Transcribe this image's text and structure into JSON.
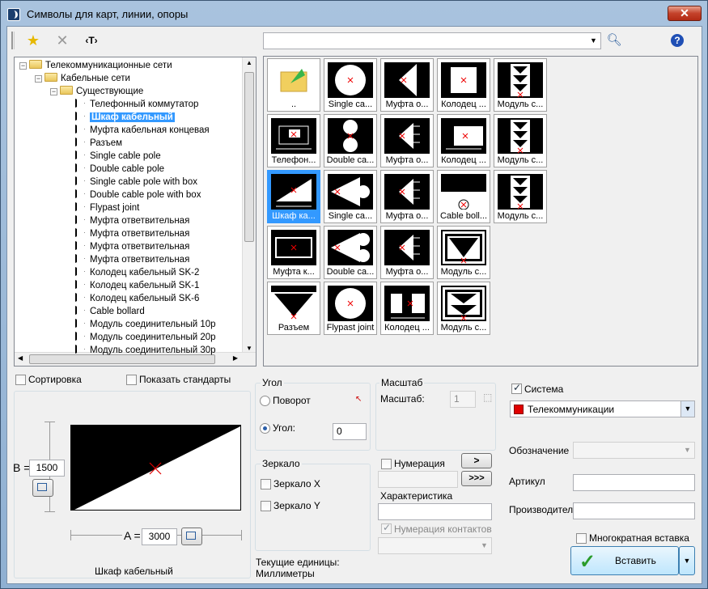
{
  "window": {
    "title": "Символы для карт, линии, опоры",
    "close": "✕"
  },
  "toolbar": {
    "text_tool": "‹T›",
    "search_placeholder": "",
    "help": "?"
  },
  "tree": [
    {
      "label": "Телекоммуникационные сети",
      "level": 0,
      "type": "folder",
      "toggle": "−"
    },
    {
      "label": "Кабельные сети",
      "level": 1,
      "type": "folder",
      "toggle": "−"
    },
    {
      "label": "Существующие",
      "level": 2,
      "type": "folder",
      "toggle": "−"
    },
    {
      "label": "Телефонный коммутатор",
      "level": 3,
      "type": "sym"
    },
    {
      "label": "Шкаф кабельный",
      "level": 3,
      "type": "sym",
      "selected": true
    },
    {
      "label": "Муфта кабельная концевая",
      "level": 3,
      "type": "sym"
    },
    {
      "label": "Разъем",
      "level": 3,
      "type": "sym"
    },
    {
      "label": "Single cable pole",
      "level": 3,
      "type": "sym"
    },
    {
      "label": "Double cable pole",
      "level": 3,
      "type": "sym"
    },
    {
      "label": "Single cable pole with box",
      "level": 3,
      "type": "sym"
    },
    {
      "label": "Double cable pole with box",
      "level": 3,
      "type": "sym"
    },
    {
      "label": "Flypast joint",
      "level": 3,
      "type": "sym"
    },
    {
      "label": "Муфта ответвительная",
      "level": 3,
      "type": "sym"
    },
    {
      "label": "Муфта ответвительная",
      "level": 3,
      "type": "sym"
    },
    {
      "label": "Муфта ответвительная",
      "level": 3,
      "type": "sym"
    },
    {
      "label": "Муфта ответвительная",
      "level": 3,
      "type": "sym"
    },
    {
      "label": "Колодец кабельный SK-2",
      "level": 3,
      "type": "sym"
    },
    {
      "label": "Колодец кабельный SK-1",
      "level": 3,
      "type": "sym"
    },
    {
      "label": "Колодец кабельный SK-6",
      "level": 3,
      "type": "sym"
    },
    {
      "label": "Cable bollard",
      "level": 3,
      "type": "sym"
    },
    {
      "label": "Модуль соединительный 10р",
      "level": 3,
      "type": "sym"
    },
    {
      "label": "Модуль соединительный 20р",
      "level": 3,
      "type": "sym"
    },
    {
      "label": "Модуль соединительный 30р",
      "level": 3,
      "type": "sym"
    }
  ],
  "grid": [
    {
      "cap": "..",
      "kind": "up"
    },
    {
      "cap": "Single ca...",
      "kind": "circle"
    },
    {
      "cap": "Муфта о...",
      "kind": "tri"
    },
    {
      "cap": "Колодец ...",
      "kind": "box"
    },
    {
      "cap": "Модуль с...",
      "kind": "mod"
    },
    {
      "cap": "Телефон...",
      "kind": "tel"
    },
    {
      "cap": "Double ca...",
      "kind": "dbl"
    },
    {
      "cap": "Муфта о...",
      "kind": "tri2"
    },
    {
      "cap": "Колодец ...",
      "kind": "box2"
    },
    {
      "cap": "Модуль с...",
      "kind": "mod"
    },
    {
      "cap": "Шкаф ка...",
      "kind": "cab",
      "selected": true
    },
    {
      "cap": "Single ca...",
      "kind": "pole"
    },
    {
      "cap": "Муфта о...",
      "kind": "tri2"
    },
    {
      "cap": "Cable boll...",
      "kind": "boll"
    },
    {
      "cap": "Модуль с...",
      "kind": "mod"
    },
    {
      "cap": "Муфта к...",
      "kind": "rect"
    },
    {
      "cap": "Double ca...",
      "kind": "dpole"
    },
    {
      "cap": "Муфта о...",
      "kind": "tri2"
    },
    {
      "cap": "Модуль с...",
      "kind": "vmod"
    },
    {
      "cap": "Разъем",
      "kind": "vtri"
    },
    {
      "cap": "Flypast joint",
      "kind": "circle"
    },
    {
      "cap": "Колодец ...",
      "kind": "box3"
    },
    {
      "cap": "Модуль с...",
      "kind": "vmod2"
    }
  ],
  "options": {
    "sort": "Сортировка",
    "show_std": "Показать стандарты"
  },
  "preview": {
    "b_label": "B =",
    "b_value": "1500",
    "a_label": "A =",
    "a_value": "3000",
    "name": "Шкаф кабельный"
  },
  "angle": {
    "group": "Угол",
    "rotate": "Поворот",
    "angle": "Угол:",
    "value": "0"
  },
  "scale": {
    "group": "Масштаб",
    "label": "Масштаб:",
    "value": "1"
  },
  "mirror": {
    "group": "Зеркало",
    "x": "Зеркало X",
    "y": "Зеркало Y"
  },
  "units": {
    "line1": "Текущие единицы:",
    "line2": "Миллиметры"
  },
  "numbering": {
    "label": "Нумерация",
    "next": ">",
    "next_all": ">>>",
    "characteristic": "Характеристика",
    "contacts": "Нумерация контактов"
  },
  "system": {
    "label": "Система",
    "value": "Телекоммуникации",
    "color": "#e00000"
  },
  "fields": {
    "designation": "Обозначение",
    "article": "Артикул",
    "maker": "Производитель"
  },
  "insert": {
    "multi": "Многократная вставка",
    "button": "Вставить"
  }
}
